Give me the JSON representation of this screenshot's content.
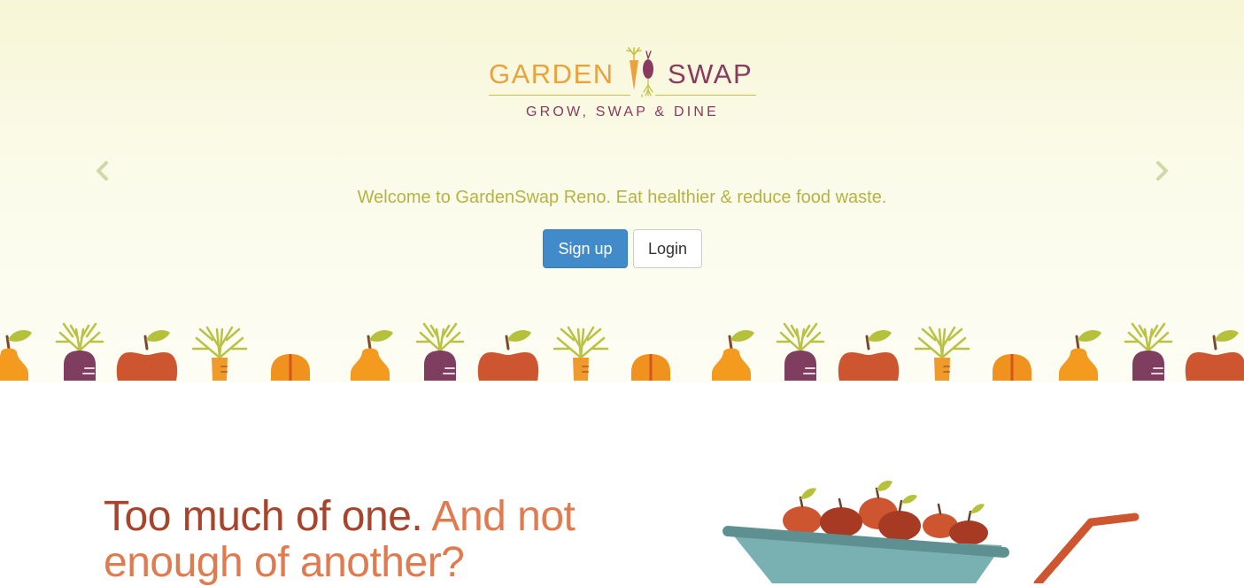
{
  "brand": {
    "name_left": "GARDEN",
    "name_right": "SWAP",
    "tagline": "GROW, SWAP & DINE",
    "colors": {
      "orange": "#eba13c",
      "plum": "#8a3a5e",
      "green": "#b5b342"
    }
  },
  "carousel": {
    "prev_icon": "chevron-left-icon",
    "next_icon": "chevron-right-icon",
    "welcome": "Welcome to GardenSwap Reno. Eat healthier & reduce food waste.",
    "signup_label": "Sign up",
    "login_label": "Login"
  },
  "border_icons": [
    "apple-icon",
    "beet-icon",
    "carrot-icon",
    "pumpkin-icon"
  ],
  "section": {
    "headline_part1": "Too much of one.",
    "headline_part2": "And not enough of another?",
    "illustration": "wheelbarrow-of-apples-icon"
  }
}
